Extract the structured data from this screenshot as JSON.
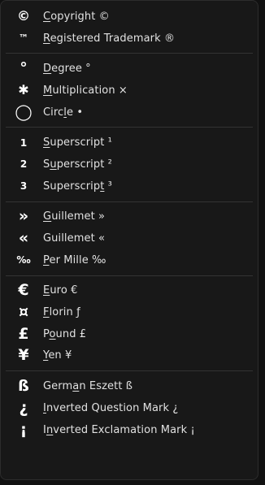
{
  "groups": [
    {
      "items": [
        {
          "icon": "©",
          "icon_name": "copyright-icon",
          "pre": "",
          "ul": "C",
          "post": "opyright ©"
        },
        {
          "icon": "™",
          "icon_name": "trademark-icon",
          "pre": "",
          "ul": "R",
          "post": "egistered Trademark ®"
        }
      ]
    },
    {
      "items": [
        {
          "icon": "°",
          "icon_name": "degree-icon",
          "pre": "",
          "ul": "D",
          "post": "egree °"
        },
        {
          "icon": "✱",
          "icon_name": "multiplication-icon",
          "pre": "",
          "ul": "M",
          "post": "ultiplication ×"
        },
        {
          "icon": "◯",
          "icon_name": "circle-icon",
          "pre": "Circ",
          "ul": "l",
          "post": "e •"
        }
      ]
    },
    {
      "items": [
        {
          "icon": "1",
          "icon_name": "superscript-one-icon",
          "pre": "",
          "ul": "S",
          "post": "uperscript ¹"
        },
        {
          "icon": "2",
          "icon_name": "superscript-two-icon",
          "pre": "S",
          "ul": "u",
          "post": "perscript ²"
        },
        {
          "icon": "3",
          "icon_name": "superscript-three-icon",
          "pre": "Superscrip",
          "ul": "t",
          "post": " ³"
        }
      ]
    },
    {
      "items": [
        {
          "icon": "»",
          "icon_name": "guillemet-right-icon",
          "pre": "",
          "ul": "G",
          "post": "uillemet »"
        },
        {
          "icon": "«",
          "icon_name": "guillemet-left-icon",
          "pre": "Guillemet «",
          "ul": "",
          "post": ""
        },
        {
          "icon": "‰",
          "icon_name": "per-mille-icon",
          "pre": "",
          "ul": "P",
          "post": "er Mille ‰"
        }
      ]
    },
    {
      "items": [
        {
          "icon": "€",
          "icon_name": "euro-icon",
          "pre": "",
          "ul": "E",
          "post": "uro €"
        },
        {
          "icon": "¤",
          "icon_name": "florin-icon",
          "pre": "",
          "ul": "F",
          "post": "lorin ƒ"
        },
        {
          "icon": "£",
          "icon_name": "pound-icon",
          "pre": "P",
          "ul": "o",
          "post": "und £"
        },
        {
          "icon": "¥",
          "icon_name": "yen-icon",
          "pre": "",
          "ul": "Y",
          "post": "en ¥"
        }
      ]
    },
    {
      "items": [
        {
          "icon": "ß",
          "icon_name": "eszett-icon",
          "pre": "Germ",
          "ul": "a",
          "post": "n Eszett ß"
        },
        {
          "icon": "¿",
          "icon_name": "inverted-question-mark-icon",
          "pre": "",
          "ul": "I",
          "post": "nverted Question Mark ¿"
        },
        {
          "icon": "¡",
          "icon_name": "inverted-exclamation-mark-icon",
          "pre": "I",
          "ul": "n",
          "post": "verted Exclamation Mark ¡"
        }
      ]
    }
  ]
}
